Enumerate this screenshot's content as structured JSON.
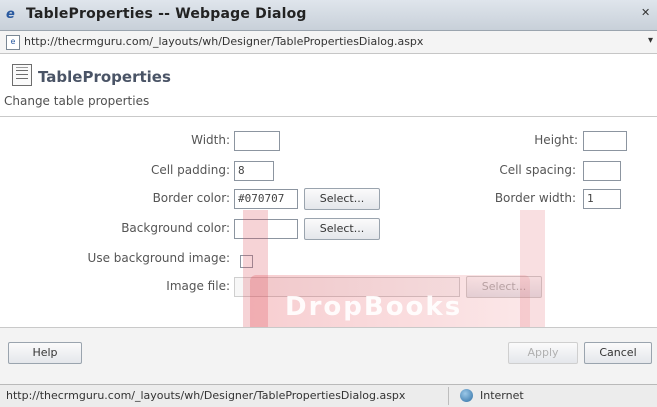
{
  "window": {
    "title": "TableProperties -- Webpage Dialog",
    "address_url": "http://thecrmguru.com/_layouts/wh/Designer/TablePropertiesDialog.aspx"
  },
  "header": {
    "title": "TableProperties",
    "subtitle": "Change table properties"
  },
  "form": {
    "width_label": "Width:",
    "width_value": "",
    "height_label": "Height:",
    "height_value": "",
    "cell_padding_label": "Cell padding:",
    "cell_padding_value": "8",
    "cell_spacing_label": "Cell spacing:",
    "cell_spacing_value": "",
    "border_color_label": "Border color:",
    "border_color_value": "#070707",
    "border_color_select": "Select...",
    "border_width_label": "Border width:",
    "border_width_value": "1",
    "bg_color_label": "Background color:",
    "bg_color_value": "",
    "bg_color_select": "Select...",
    "use_bg_image_label": "Use background image:",
    "image_file_label": "Image file:",
    "image_file_value": "",
    "image_file_select": "Select..."
  },
  "footer": {
    "help": "Help",
    "apply": "Apply",
    "cancel": "Cancel"
  },
  "statusbar": {
    "url": "http://thecrmguru.com/_layouts/wh/Designer/TablePropertiesDialog.aspx",
    "zone": "Internet"
  },
  "watermark": {
    "text": "DropBooks"
  }
}
